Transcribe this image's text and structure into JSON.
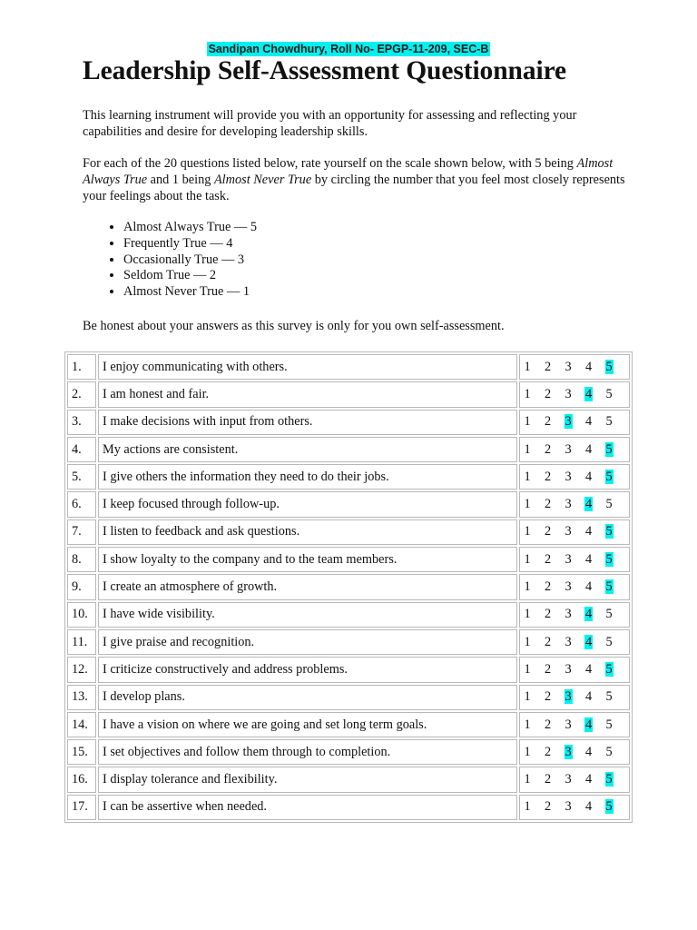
{
  "header": {
    "author_line": "Sandipan Chowdhury, Roll No- EPGP-11-209, SEC-B",
    "highlight_color": "#00f0f0"
  },
  "title": "Leadership Self-Assessment Questionnaire",
  "intro": "This learning instrument will provide you with an opportunity for assessing and reflecting your capabilities and desire for developing leadership skills.",
  "instructions": {
    "part1": "For each of the 20 questions listed below, rate yourself on the scale shown below, with 5 being ",
    "italic1": "Almost Always True",
    "part2": " and 1 being ",
    "italic2": "Almost Never True",
    "part3": " by circling the number that you feel most closely represents your feelings about the task."
  },
  "scale": [
    "Almost Always True — 5",
    "Frequently True — 4",
    "Occasionally True — 3",
    "Seldom True — 2",
    "Almost Never True — 1"
  ],
  "honesty_note": "Be honest about your answers as this survey is only for you own self-assessment.",
  "rating_options": [
    "1",
    "2",
    "3",
    "4",
    "5"
  ],
  "questions": [
    {
      "num": "1.",
      "text": "I enjoy communicating with others.",
      "selected": 5
    },
    {
      "num": "2.",
      "text": "I am honest and fair.",
      "selected": 4
    },
    {
      "num": "3.",
      "text": "I make decisions with input from others.",
      "selected": 3
    },
    {
      "num": "4.",
      "text": "My actions are consistent.",
      "selected": 5
    },
    {
      "num": "5.",
      "text": "I give others the information they need to do their jobs.",
      "selected": 5
    },
    {
      "num": "6.",
      "text": "I keep focused through follow-up.",
      "selected": 4
    },
    {
      "num": "7.",
      "text": "I listen to feedback and ask questions.",
      "selected": 5
    },
    {
      "num": "8.",
      "text": "I show loyalty to the company and to the team members.",
      "selected": 5
    },
    {
      "num": "9.",
      "text": "I create an atmosphere of growth.",
      "selected": 5
    },
    {
      "num": "10.",
      "text": "I have wide visibility.",
      "selected": 4
    },
    {
      "num": "11.",
      "text": "I give praise and recognition.",
      "selected": 4
    },
    {
      "num": "12.",
      "text": "I criticize constructively and address problems.",
      "selected": 5
    },
    {
      "num": "13.",
      "text": "I develop plans.",
      "selected": 3
    },
    {
      "num": "14.",
      "text": "I have a vision on where we are going and set long term goals.",
      "selected": 4
    },
    {
      "num": "15.",
      "text": "I set objectives and follow them through to completion.",
      "selected": 3
    },
    {
      "num": "16.",
      "text": "I display tolerance and flexibility.",
      "selected": 5
    },
    {
      "num": "17.",
      "text": "I can be assertive when needed.",
      "selected": 5
    }
  ]
}
